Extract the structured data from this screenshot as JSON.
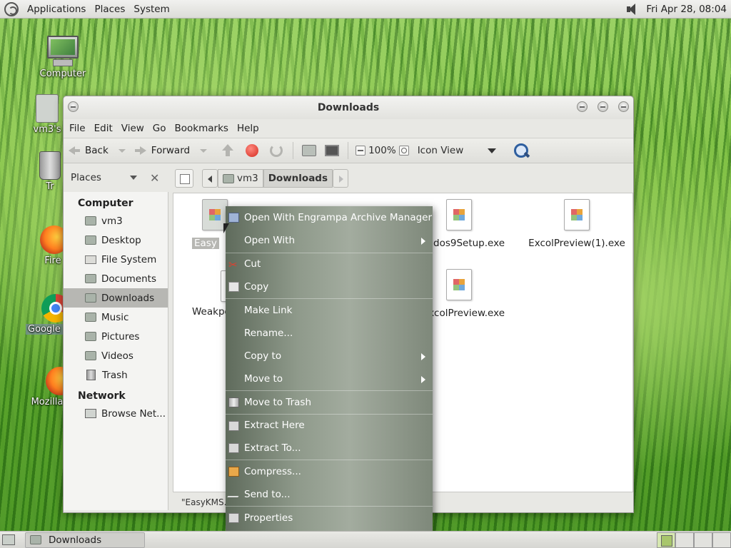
{
  "top_panel": {
    "menus": [
      "Applications",
      "Places",
      "System"
    ],
    "clock": "Fri Apr 28, 08:04"
  },
  "desktop_icons": [
    {
      "label": "Computer"
    },
    {
      "label": "vm3's"
    },
    {
      "label": "Tr"
    },
    {
      "label": "Fire"
    },
    {
      "label": "Google"
    },
    {
      "label": "Mozilla"
    }
  ],
  "window": {
    "title": "Downloads",
    "menubar": [
      "File",
      "Edit",
      "View",
      "Go",
      "Bookmarks",
      "Help"
    ],
    "toolbar": {
      "back_label": "Back",
      "forward_label": "Forward",
      "zoom_level": "100%",
      "view_mode": "Icon View"
    },
    "sidebar": {
      "header": "Places",
      "sections": [
        {
          "title": "Computer",
          "items": [
            "vm3",
            "Desktop",
            "File System",
            "Documents",
            "Downloads",
            "Music",
            "Pictures",
            "Videos",
            "Trash"
          ]
        },
        {
          "title": "Network",
          "items": [
            "Browse Net..."
          ]
        }
      ],
      "active_item": "Downloads"
    },
    "breadcrumbs": [
      "vm3",
      "Downloads"
    ],
    "files": [
      {
        "name": "Easy"
      },
      {
        "name": "ndos9Setup.exe"
      },
      {
        "name": "ExcolPreview(1).exe"
      },
      {
        "name": "Weakpo"
      },
      {
        "name": "xcolPreview.exe"
      }
    ],
    "status_text": "\"EasyKMS.is"
  },
  "context_menu": {
    "items": [
      {
        "label": "Open With Engrampa Archive Manager",
        "icon": "archive-icon",
        "submenu": false
      },
      {
        "label": "Open With",
        "icon": "",
        "submenu": true
      },
      {
        "label": "Cut",
        "icon": "scissors-icon",
        "submenu": false
      },
      {
        "label": "Copy",
        "icon": "copy-icon",
        "submenu": false
      },
      {
        "label": "Make Link",
        "icon": "",
        "submenu": false
      },
      {
        "label": "Rename...",
        "icon": "",
        "submenu": false
      },
      {
        "label": "Copy to",
        "icon": "",
        "submenu": true
      },
      {
        "label": "Move to",
        "icon": "",
        "submenu": true
      },
      {
        "label": "Move to Trash",
        "icon": "trash-icon",
        "submenu": false
      },
      {
        "label": "Extract Here",
        "icon": "extract-icon",
        "submenu": false
      },
      {
        "label": "Extract To...",
        "icon": "extract-icon",
        "submenu": false
      },
      {
        "label": "Compress...",
        "icon": "compress-icon",
        "submenu": false
      },
      {
        "label": "Send to...",
        "icon": "send-icon",
        "submenu": false
      },
      {
        "label": "Properties",
        "icon": "properties-icon",
        "submenu": false
      }
    ]
  },
  "bottom_panel": {
    "task_label": "Downloads"
  }
}
